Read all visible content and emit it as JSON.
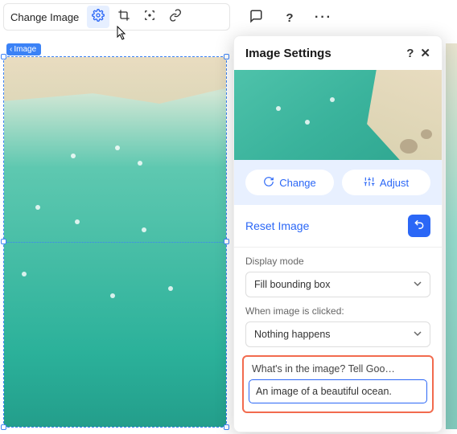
{
  "toolbar": {
    "change_image_label": "Change Image"
  },
  "chip": {
    "label": "Image"
  },
  "panel": {
    "title": "Image Settings",
    "actions": {
      "change": "Change",
      "adjust": "Adjust"
    },
    "reset_label": "Reset Image",
    "display_mode": {
      "label": "Display mode",
      "value": "Fill bounding box"
    },
    "click_action": {
      "label": "When image is clicked:",
      "value": "Nothing happens"
    },
    "alt": {
      "label": "What's in the image? Tell Goo…",
      "value": "An image of a beautiful ocean."
    }
  }
}
